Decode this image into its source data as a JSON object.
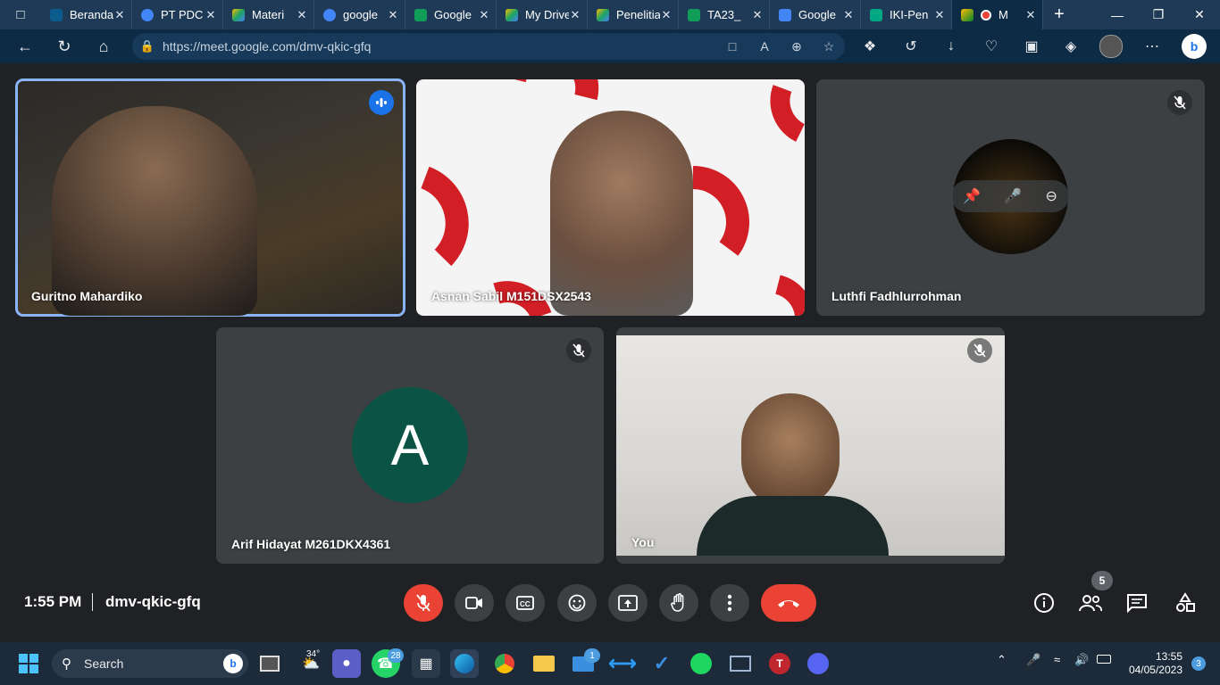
{
  "browser": {
    "tabs": [
      {
        "label": "Beranda",
        "color": "#0b5c8c"
      },
      {
        "label": "PT PDC",
        "color": "#4285f4"
      },
      {
        "label": "Materi",
        "color": "#1ea362"
      },
      {
        "label": "google",
        "color": "#4285f4"
      },
      {
        "label": "Google",
        "color": "#0f9d58"
      },
      {
        "label": "My Drive",
        "color": "#fbbc04"
      },
      {
        "label": "Penelitian",
        "color": "#1ea362"
      },
      {
        "label": "TA23_",
        "color": "#0f9d58"
      },
      {
        "label": "Google",
        "color": "#4285f4"
      },
      {
        "label": "IKI-Pen",
        "color": "#00a884"
      },
      {
        "label": "M",
        "color": "#ea4335"
      }
    ],
    "url": "https://meet.google.com/dmv-qkic-gfq"
  },
  "participants": [
    {
      "name": "Guritno Mahardiko"
    },
    {
      "name": "Asnan Sabil M151DSX2543"
    },
    {
      "name": "Luthfi Fadhlurrohman"
    },
    {
      "name": "Arif Hidayat M261DKX4361",
      "initial": "A"
    },
    {
      "name": "You"
    }
  ],
  "meeting": {
    "time": "1:55 PM",
    "code": "dmv-qkic-gfq",
    "participant_count": "5"
  },
  "taskbar": {
    "search_label": "Search",
    "weather": "34°",
    "whatsapp_badge": "28",
    "mail_badge": "1",
    "clock_time": "13:55",
    "clock_date": "04/05/2023",
    "notification_count": "3"
  },
  "colors": {
    "meet_bg": "#202124",
    "tile_bg": "#3c4043",
    "red": "#ea4335",
    "active_outline": "#8ab4f8",
    "avatar_green": "#0b5345"
  }
}
